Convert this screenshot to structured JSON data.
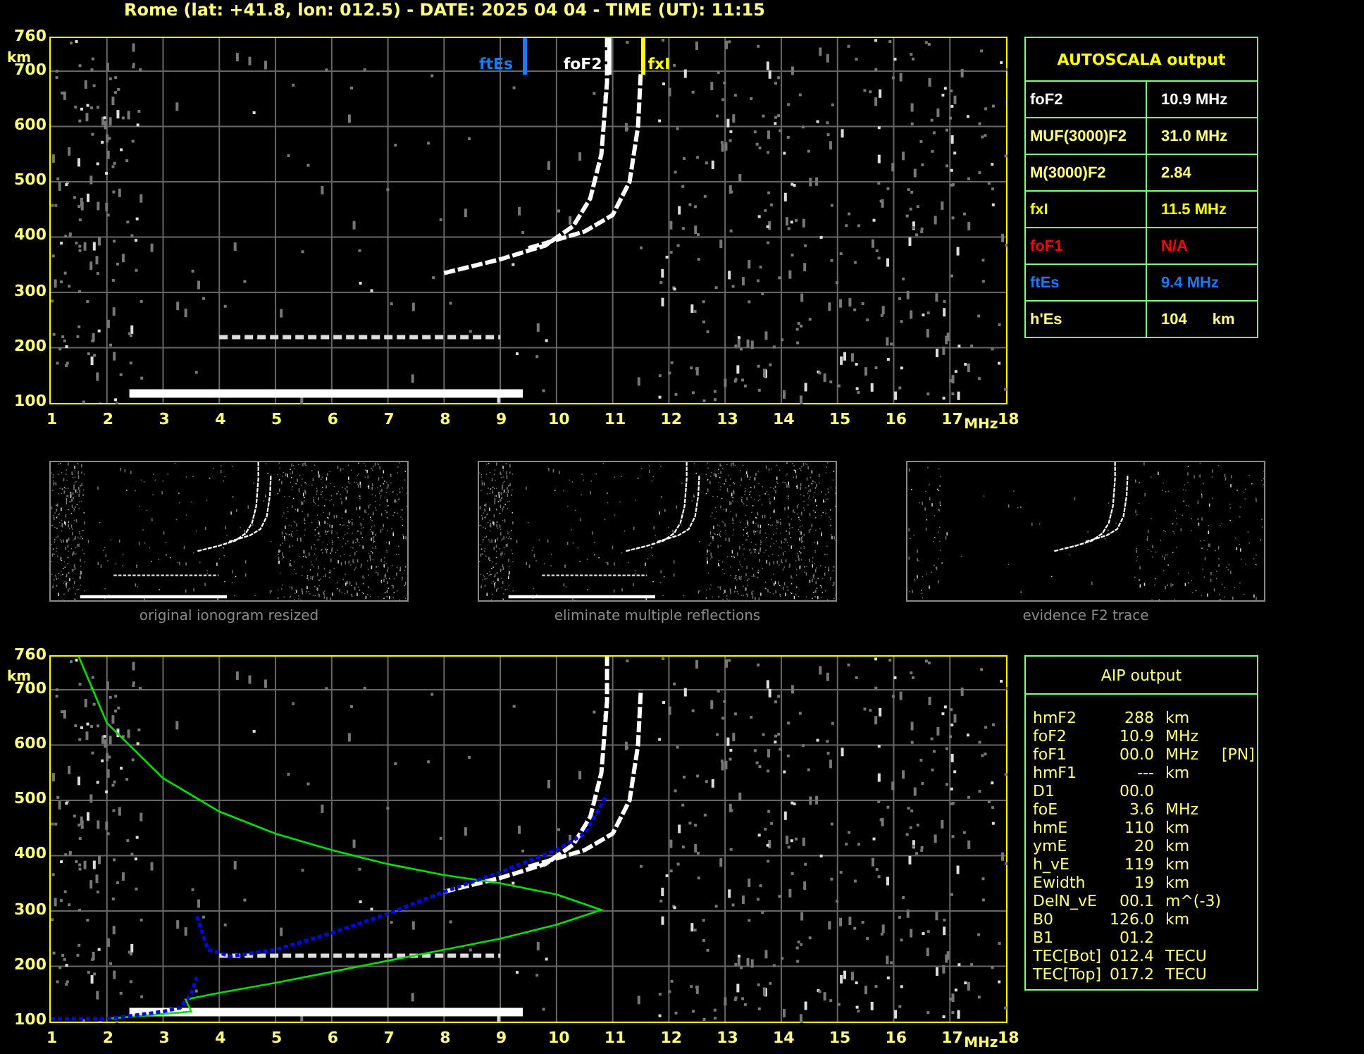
{
  "title": "Rome (lat: +41.8, lon: 012.5) - DATE: 2025 04 04 - TIME (UT): 11:15",
  "top_plot": {
    "y_unit": "km",
    "x_unit": "MHz",
    "y_ticks": [
      "760",
      "700",
      "600",
      "500",
      "400",
      "300",
      "200",
      "100"
    ],
    "x_ticks": [
      "1",
      "2",
      "3",
      "4",
      "5",
      "6",
      "7",
      "8",
      "9",
      "10",
      "11",
      "12",
      "13",
      "14",
      "15",
      "16",
      "17",
      "18"
    ],
    "markers": [
      {
        "label": "ftEs",
        "kind": "sporadic",
        "color": "#1e78ff"
      },
      {
        "label": "foF2",
        "kind": "main",
        "color": "#ffffff"
      },
      {
        "label": "fxI",
        "kind": "extra",
        "color": "#ffff00"
      }
    ]
  },
  "autoscala": {
    "title": "AUTOSCALA output",
    "rows": [
      {
        "name": "foF2",
        "value": "10.9 MHz",
        "kind": "main"
      },
      {
        "name": "MUF(3000)F2",
        "value": "31.0 MHz",
        "kind": "derived"
      },
      {
        "name": "M(3000)F2",
        "value": "2.84",
        "kind": "derived"
      },
      {
        "name": "fxI",
        "value": "11.5 MHz",
        "kind": "extra"
      },
      {
        "name": "foF1",
        "value": "N/A",
        "kind": "missing"
      },
      {
        "name": "ftEs",
        "value": "9.4 MHz",
        "kind": "sporadic"
      },
      {
        "name": "h'Es",
        "value": "104",
        "unit": "km",
        "kind": "derived"
      }
    ]
  },
  "thumbnails": [
    {
      "caption": "original ionogram resized",
      "kind": "full"
    },
    {
      "caption": "eliminate multiple reflections",
      "kind": "full"
    },
    {
      "caption": "evidence F2 trace",
      "kind": "f2"
    }
  ],
  "bottom_plot": {
    "y_unit": "km",
    "x_unit": "MHz",
    "y_ticks": [
      "760",
      "700",
      "600",
      "500",
      "400",
      "300",
      "200",
      "100"
    ],
    "x_ticks": [
      "1",
      "2",
      "3",
      "4",
      "5",
      "6",
      "7",
      "8",
      "9",
      "10",
      "11",
      "12",
      "13",
      "14",
      "15",
      "16",
      "17",
      "18"
    ]
  },
  "aip": {
    "title": "AIP output",
    "rows": [
      {
        "name": "hmF2",
        "value": "288",
        "unit": "km"
      },
      {
        "name": "foF2",
        "value": "10.9",
        "unit": "MHz"
      },
      {
        "name": "foF1",
        "value": "00.0",
        "unit": "MHz",
        "note": "[PN]"
      },
      {
        "name": "hmF1",
        "value": "---",
        "unit": "km"
      },
      {
        "name": "D1",
        "value": "00.0"
      },
      {
        "name": "foE",
        "value": "3.6",
        "unit": "MHz"
      },
      {
        "name": "hmE",
        "value": "110",
        "unit": "km"
      },
      {
        "name": "ymE",
        "value": "20",
        "unit": "km"
      },
      {
        "name": "h_vE",
        "value": "119",
        "unit": "km"
      },
      {
        "name": "Ewidth",
        "value": "19",
        "unit": "km"
      },
      {
        "name": "DelN_vE",
        "value": "00.1",
        "unit": "m^(-3)"
      },
      {
        "name": "B0",
        "value": "126.0",
        "unit": "km"
      },
      {
        "name": "B1",
        "value": "01.2"
      },
      {
        "name": "TEC[Bot]",
        "value": "012.4",
        "unit": "TECU"
      },
      {
        "name": "TEC[Top]",
        "value": "017.2",
        "unit": "TECU"
      }
    ]
  }
}
